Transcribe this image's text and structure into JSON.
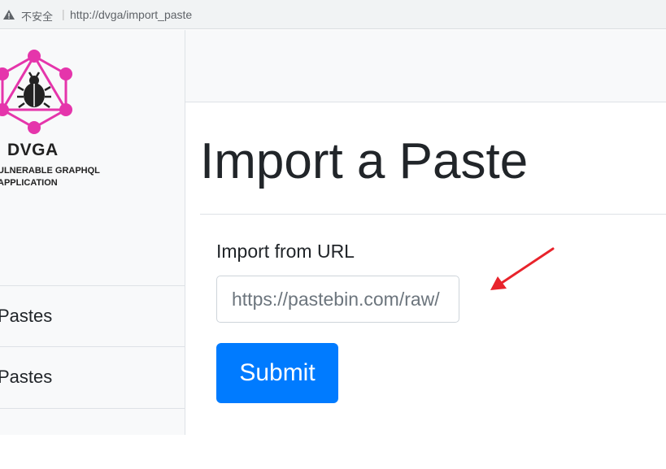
{
  "browser": {
    "security_label": "不安全",
    "separator": "|",
    "url": "http://dvga/import_paste"
  },
  "sidebar": {
    "logo": {
      "name": "DVGA",
      "subtitle_line1": "ULNERABLE GRAPHQL",
      "subtitle_line2": "APPLICATION"
    },
    "items": [
      {
        "label": "Pastes"
      },
      {
        "label": "Pastes"
      }
    ]
  },
  "main": {
    "title": "Import a Paste",
    "form": {
      "url_label": "Import from URL",
      "url_placeholder": "https://pastebin.com/raw/",
      "submit_label": "Submit"
    }
  },
  "colors": {
    "accent": "#007bff",
    "logo_pink": "#e535ab",
    "annotation_arrow": "#e8232b"
  }
}
